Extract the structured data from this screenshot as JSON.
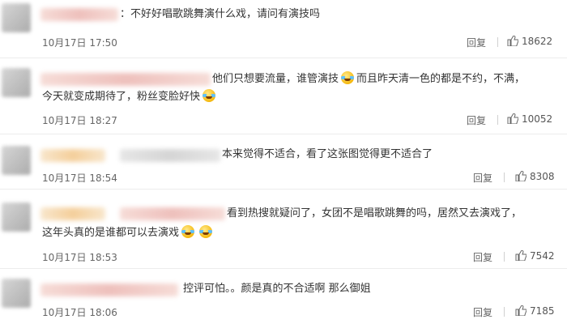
{
  "comments": [
    {
      "text_line1": "：不好好唱歌跳舞演什么戏，请问有演技吗",
      "time": "10月17日 17:50",
      "reply_label": "回复",
      "likes": "18622",
      "icon": "thumbs-up-icon"
    },
    {
      "text_line1": "他们只想要流量，谁管演技",
      "text_line1b": "而且昨天清一色的都是不约，不满，",
      "text_line2": "今天就变成期待了，粉丝变脸好快",
      "time": "10月17日 18:27",
      "reply_label": "回复",
      "likes": "10052",
      "icon": "thumbs-up-icon"
    },
    {
      "text_line1": "本来觉得不适合，看了这张图觉得更不适合了",
      "time": "10月17日 18:54",
      "reply_label": "回复",
      "likes": "8308",
      "icon": "thumbs-up-icon"
    },
    {
      "text_line1": "看到热搜就疑问了，女团不是唱歌跳舞的吗，居然又去演戏了，",
      "text_line2": "这年头真的是谁都可以去演戏",
      "time": "10月17日 18:53",
      "reply_label": "回复",
      "likes": "7542",
      "icon": "thumbs-up-icon"
    },
    {
      "text_line1": "控评可怕。。颜是真的不合适啊 那么御姐",
      "time": "10月17日 18:06",
      "reply_label": "回复",
      "likes": "7185",
      "icon": "thumbs-up-icon"
    }
  ],
  "colors": {
    "text": "#333333",
    "meta": "#666666",
    "divider": "#ececec"
  }
}
